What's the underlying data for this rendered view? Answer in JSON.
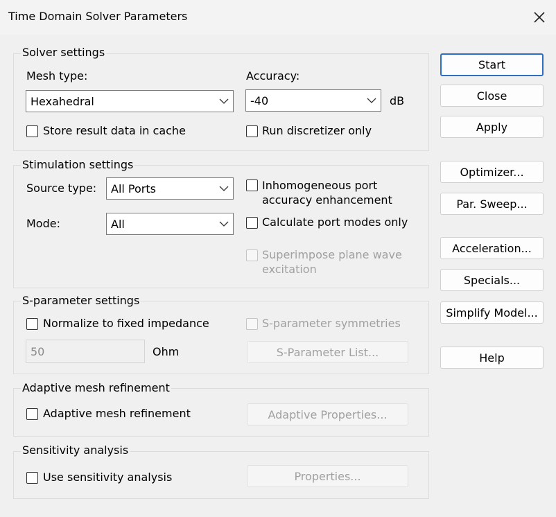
{
  "window": {
    "title": "Time Domain Solver Parameters"
  },
  "solver": {
    "legend": "Solver settings",
    "mesh_type_label": "Mesh type:",
    "mesh_type_value": "Hexahedral",
    "accuracy_label": "Accuracy:",
    "accuracy_value": "-40",
    "accuracy_unit": "dB",
    "store_cache_label": "Store result data in cache",
    "run_discretizer_label": "Run discretizer only"
  },
  "stimulation": {
    "legend": "Stimulation settings",
    "source_type_label": "Source type:",
    "source_type_value": "All Ports",
    "mode_label": "Mode:",
    "mode_value": "All",
    "inhomogeneous_line1": "Inhomogeneous port",
    "inhomogeneous_line2": "accuracy enhancement",
    "calc_port_modes_label": "Calculate port modes only",
    "superimpose_line1": "Superimpose plane wave",
    "superimpose_line2": "excitation"
  },
  "sparam": {
    "legend": "S-parameter settings",
    "normalize_label": "Normalize to fixed impedance",
    "impedance_value": "50",
    "impedance_unit": "Ohm",
    "symmetries_label": "S-parameter symmetries",
    "list_button": "S-Parameter List..."
  },
  "adaptive": {
    "legend": "Adaptive mesh refinement",
    "checkbox_label": "Adaptive mesh refinement",
    "properties_button": "Adaptive Properties..."
  },
  "sensitivity": {
    "legend": "Sensitivity analysis",
    "checkbox_label": "Use sensitivity analysis",
    "properties_button": "Properties..."
  },
  "buttons": {
    "start": "Start",
    "close": "Close",
    "apply": "Apply",
    "optimizer": "Optimizer...",
    "par_sweep": "Par. Sweep...",
    "acceleration": "Acceleration...",
    "specials": "Specials...",
    "simplify": "Simplify Model...",
    "help": "Help"
  },
  "colors": {
    "default_button_border": "#2f6fc0",
    "group_border": "#dcdcdc",
    "disabled_text": "#a0a0a0"
  }
}
